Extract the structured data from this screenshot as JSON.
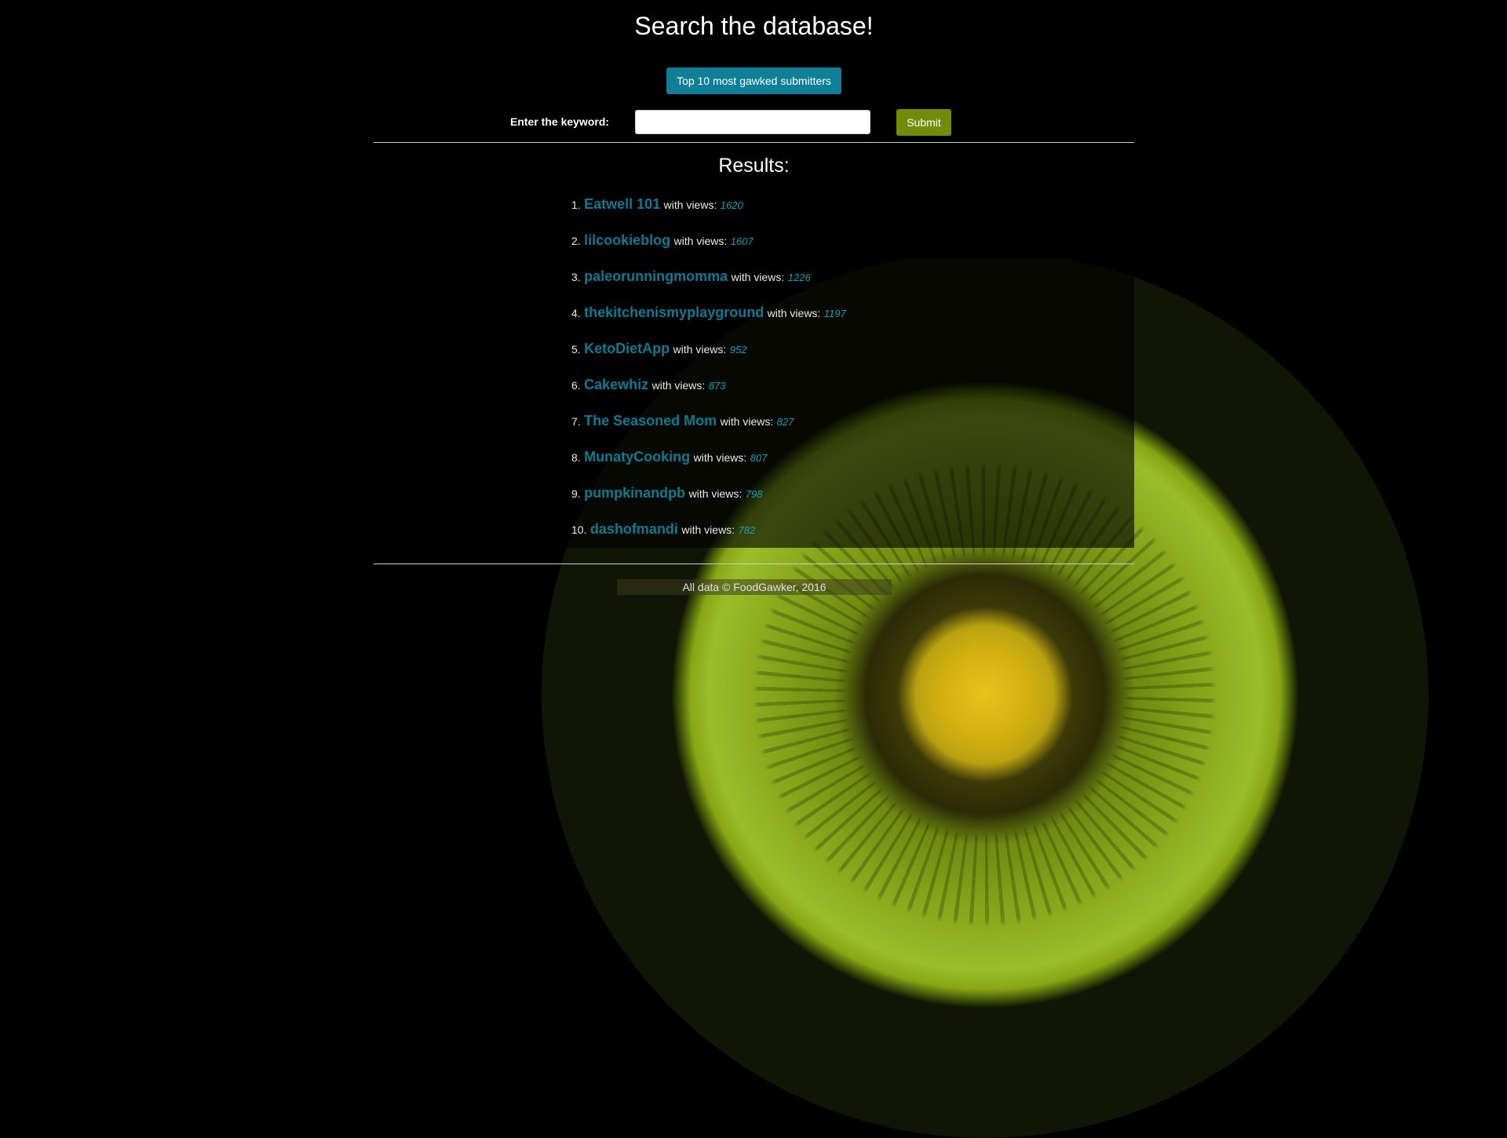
{
  "header": {
    "title": "Search the database!",
    "top_button_label": "Top 10 most gawked submitters"
  },
  "search": {
    "label": "Enter the keyword:",
    "value": "",
    "placeholder": "",
    "submit_label": "Submit"
  },
  "results": {
    "title": "Results:",
    "with_views_label": "with views:",
    "items": [
      {
        "rank": "1.",
        "name": "Eatwell 101",
        "views": "1620"
      },
      {
        "rank": "2.",
        "name": "lilcookieblog",
        "views": "1607"
      },
      {
        "rank": "3.",
        "name": "paleorunningmomma",
        "views": "1226"
      },
      {
        "rank": "4.",
        "name": "thekitchenismyplayground",
        "views": "1197"
      },
      {
        "rank": "5.",
        "name": "KetoDietApp",
        "views": "952"
      },
      {
        "rank": "6.",
        "name": "Cakewhiz",
        "views": "873"
      },
      {
        "rank": "7.",
        "name": "The Seasoned Mom",
        "views": "827"
      },
      {
        "rank": "8.",
        "name": "MunatyCooking",
        "views": "807"
      },
      {
        "rank": "9.",
        "name": "pumpkinandpb",
        "views": "798"
      },
      {
        "rank": "10.",
        "name": "dashofmandi",
        "views": "782"
      }
    ]
  },
  "footer": {
    "text": "All data © FoodGawker, 2016"
  },
  "colors": {
    "top_button": "#0e7f96",
    "submit_button": "#748a09",
    "result_link": "#0d7a92",
    "views_value": "#14a0b8",
    "background": "#000000"
  }
}
